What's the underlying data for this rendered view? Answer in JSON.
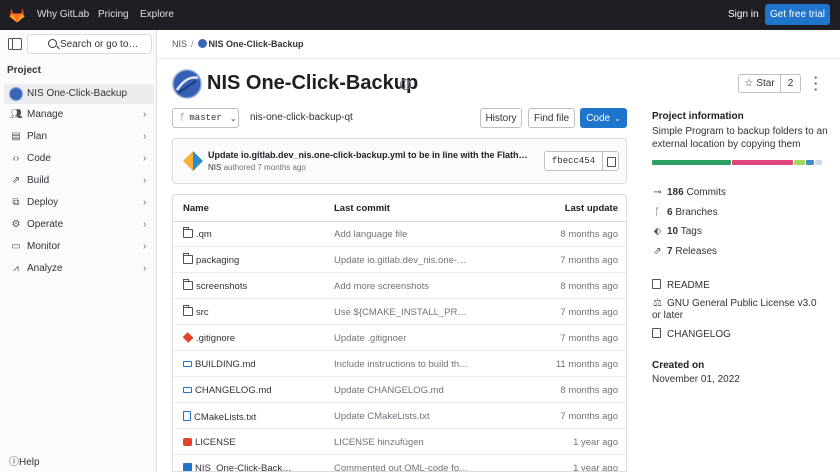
{
  "topbar": {
    "nav": [
      "Why GitLab",
      "Pricing",
      "Explore"
    ],
    "sign_in": "Sign in",
    "get_free_trial": "Get free trial"
  },
  "sidebar": {
    "search_placeholder": "Search or go to…",
    "section": "Project",
    "items": [
      {
        "label": "NIS One-Click-Backup",
        "icon": "project-avatar"
      },
      {
        "label": "Manage",
        "icon": "users-icon"
      },
      {
        "label": "Plan",
        "icon": "planning-icon"
      },
      {
        "label": "Code",
        "icon": "code-icon"
      },
      {
        "label": "Build",
        "icon": "rocket-icon"
      },
      {
        "label": "Deploy",
        "icon": "deployments-icon"
      },
      {
        "label": "Operate",
        "icon": "cloud-gear-icon"
      },
      {
        "label": "Monitor",
        "icon": "monitor-icon"
      },
      {
        "label": "Analyze",
        "icon": "chart-icon"
      }
    ],
    "help": "Help"
  },
  "breadcrumb": {
    "group": "NIS",
    "project": "NIS One-Click-Backup"
  },
  "project": {
    "title": "NIS One-Click-Backup",
    "star_label": "Star",
    "star_count": "2"
  },
  "repo": {
    "branch": "master",
    "path": "nis-one-click-backup-qt",
    "history": "History",
    "find_file": "Find file",
    "code": "Code"
  },
  "last_commit": {
    "title": "Update io.gitlab.dev_nis.one-click-backup.yml to be in line with the Flathub version",
    "author": "NIS",
    "meta": "authored 7 months ago",
    "sha": "fbecc454"
  },
  "files": {
    "headers": [
      "Name",
      "Last commit",
      "Last update"
    ],
    "rows": [
      {
        "name": ".qm",
        "icon": "folder",
        "commit": "Add language file",
        "updated": "8 months ago"
      },
      {
        "name": "packaging",
        "icon": "folder",
        "commit": "Update io.gitlab.dev_nis.one-click-backup.yml",
        "updated": "7 months ago"
      },
      {
        "name": "screenshots",
        "icon": "folder",
        "commit": "Add more screenshots",
        "updated": "8 months ago"
      },
      {
        "name": "src",
        "icon": "folder",
        "commit": "Use ${CMAKE_INSTALL_PREFIX}",
        "updated": "7 months ago"
      },
      {
        "name": ".gitignore",
        "icon": "git",
        "commit": "Update .gitignoer",
        "updated": "7 months ago"
      },
      {
        "name": "BUILDING.md",
        "icon": "md",
        "commit": "Include instructions to build the project",
        "updated": "11 months ago"
      },
      {
        "name": "CHANGELOG.md",
        "icon": "md",
        "commit": "Update CHANGELOG.md",
        "updated": "8 months ago"
      },
      {
        "name": "CMakeLists.txt",
        "icon": "doc",
        "commit": "Update CMakeLists.txt",
        "updated": "7 months ago"
      },
      {
        "name": "LICENSE",
        "icon": "lic",
        "commit": "LICENSE hinzufügen",
        "updated": "1 year ago"
      },
      {
        "name": "NIS_One-Click-Backup.qml",
        "icon": "img",
        "commit": "Commented out QML-code for the time being",
        "updated": "1 year ago"
      }
    ]
  },
  "info": {
    "title": "Project information",
    "description": "Simple Program to backup folders to an external location by copying them",
    "languages": [
      {
        "pct": 46,
        "color": "#2da160"
      },
      {
        "pct": 36,
        "color": "#e0457b"
      },
      {
        "pct": 6,
        "color": "#a4d65e"
      },
      {
        "pct": 5,
        "color": "#428bca"
      },
      {
        "pct": 4,
        "color": "#c8dde9"
      }
    ],
    "stats": [
      {
        "count": "186",
        "label": "Commits",
        "icon": "commit-icon"
      },
      {
        "count": "6",
        "label": "Branches",
        "icon": "branch-icon"
      },
      {
        "count": "10",
        "label": "Tags",
        "icon": "tag-icon"
      },
      {
        "count": "7",
        "label": "Releases",
        "icon": "rocket-icon"
      }
    ],
    "links": [
      {
        "label": "README",
        "icon": "doc-icon"
      },
      {
        "label": "GNU General Public License v3.0 or later",
        "icon": "scale-icon"
      },
      {
        "label": "CHANGELOG",
        "icon": "doc-icon"
      }
    ],
    "created_heading": "Created on",
    "created_date": "November 01, 2022"
  }
}
